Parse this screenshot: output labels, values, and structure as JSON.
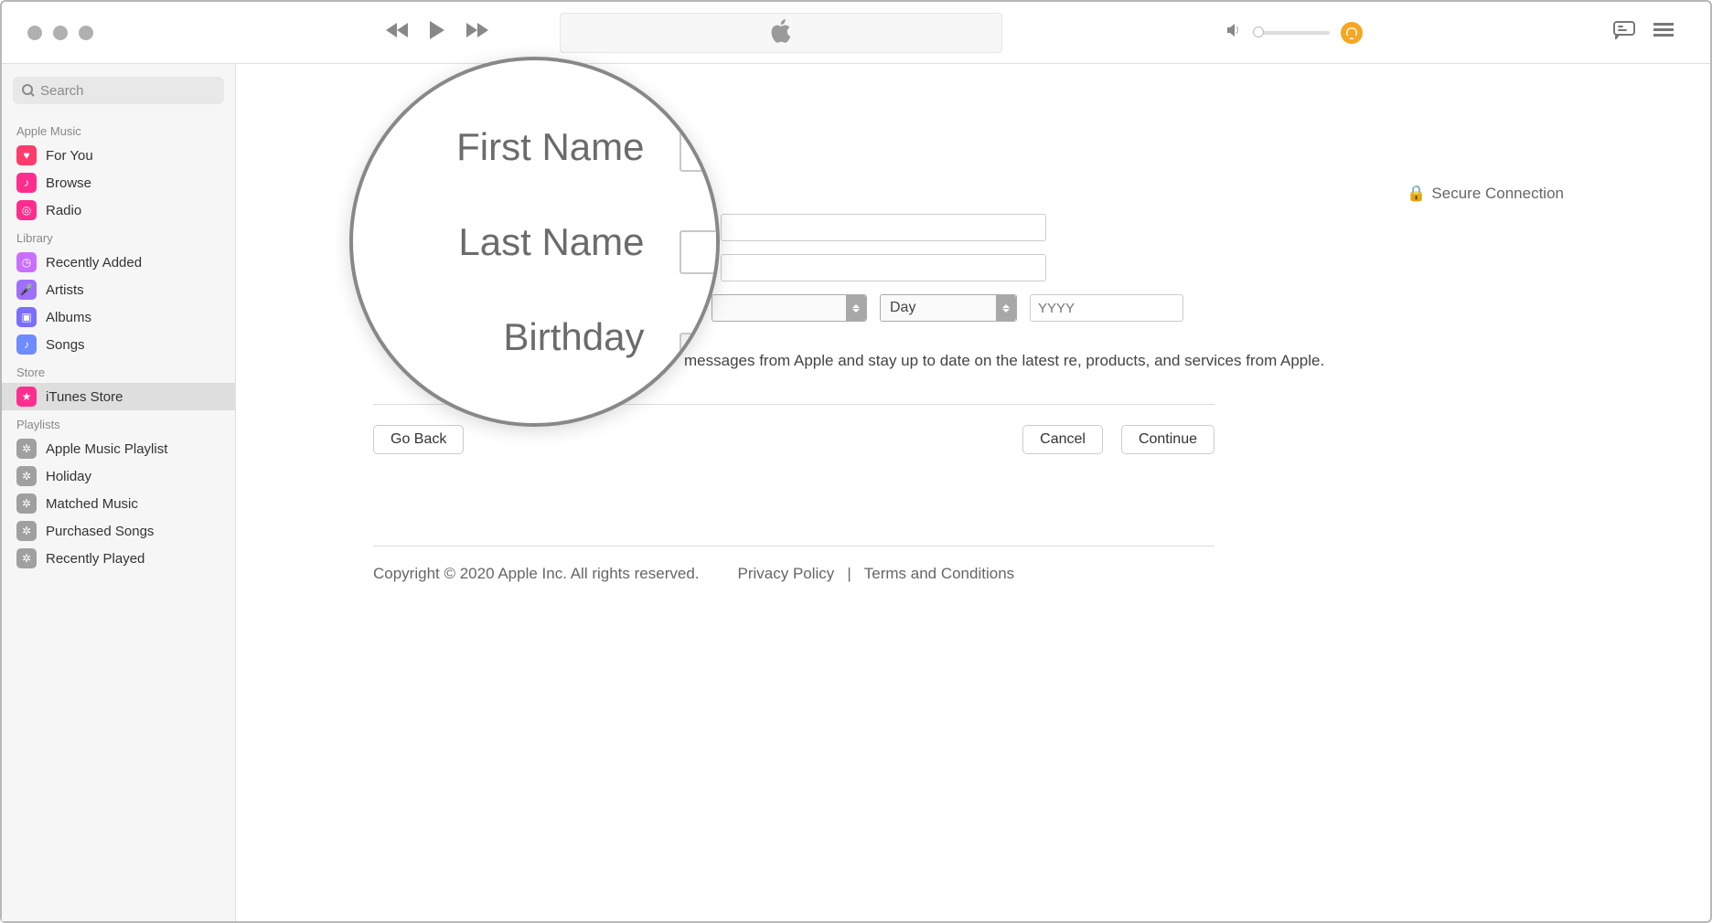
{
  "sidebar": {
    "search_placeholder": "Search",
    "sections": {
      "apple_music": {
        "label": "Apple Music",
        "items": [
          "For You",
          "Browse",
          "Radio"
        ]
      },
      "library": {
        "label": "Library",
        "items": [
          "Recently Added",
          "Artists",
          "Albums",
          "Songs"
        ]
      },
      "store": {
        "label": "Store",
        "items": [
          "iTunes Store"
        ]
      },
      "playlists": {
        "label": "Playlists",
        "items": [
          "Apple Music Playlist",
          "Holiday",
          "Matched Music",
          "Purchased Songs",
          "Recently Played"
        ]
      }
    }
  },
  "form": {
    "secure_label": "Secure Connection",
    "day_label": "Day",
    "year_placeholder": "YYYY",
    "consent_text": "messages from Apple and stay up to date on the latest re, products, and services from Apple.",
    "magnified": {
      "first": "First Name",
      "last": "Last Name",
      "birthday": "Birthday"
    }
  },
  "buttons": {
    "go_back": "Go Back",
    "cancel": "Cancel",
    "continue": "Continue"
  },
  "footer": {
    "copyright": "Copyright © 2020 Apple Inc. All rights reserved.",
    "privacy": "Privacy Policy",
    "sep": "|",
    "terms": "Terms and Conditions"
  }
}
